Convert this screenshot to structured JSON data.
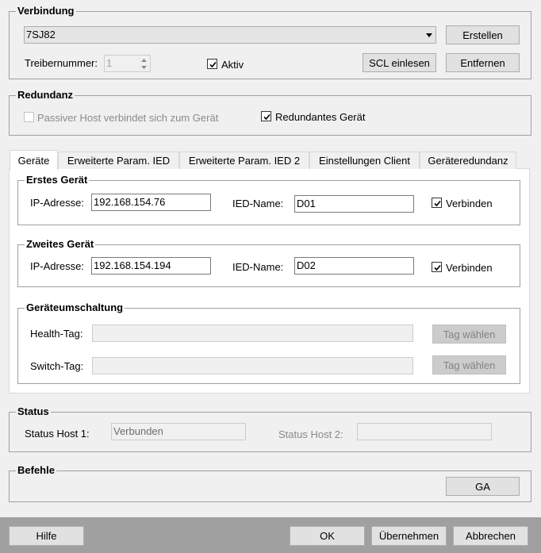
{
  "verbindung": {
    "title": "Verbindung",
    "device_value": "7SJ82",
    "create_label": "Erstellen",
    "driver_label": "Treibernummer:",
    "driver_value": "1",
    "active_label": "Aktiv",
    "scl_label": "SCL einlesen",
    "remove_label": "Entfernen"
  },
  "redundanz": {
    "title": "Redundanz",
    "passive_label": "Passiver Host verbindet sich zum Gerät",
    "redundant_label": "Redundantes Gerät"
  },
  "tabs": [
    {
      "label": "Geräte"
    },
    {
      "label": "Erweiterte Param. IED"
    },
    {
      "label": "Erweiterte Param. IED 2"
    },
    {
      "label": "Einstellungen Client"
    },
    {
      "label": "Geräteredundanz"
    }
  ],
  "first_device": {
    "title": "Erstes Gerät",
    "ip_label": "IP-Adresse:",
    "ip_value": "192.168.154.76",
    "ied_label": "IED-Name:",
    "ied_value": "D01",
    "connect_label": "Verbinden"
  },
  "second_device": {
    "title": "Zweites Gerät",
    "ip_label": "IP-Adresse:",
    "ip_value": "192.168.154.194",
    "ied_label": "IED-Name:",
    "ied_value": "D02",
    "connect_label": "Verbinden"
  },
  "switching": {
    "title": "Geräteumschaltung",
    "health_label": "Health-Tag:",
    "switch_label": "Switch-Tag:",
    "choose_tag_label": "Tag wählen"
  },
  "status": {
    "title": "Status",
    "host1_label": "Status Host 1:",
    "host1_value": "Verbunden",
    "host2_label": "Status Host 2:"
  },
  "befehle": {
    "title": "Befehle",
    "ga_label": "GA"
  },
  "footer": {
    "help_label": "Hilfe",
    "ok_label": "OK",
    "apply_label": "Übernehmen",
    "cancel_label": "Abbrechen"
  }
}
